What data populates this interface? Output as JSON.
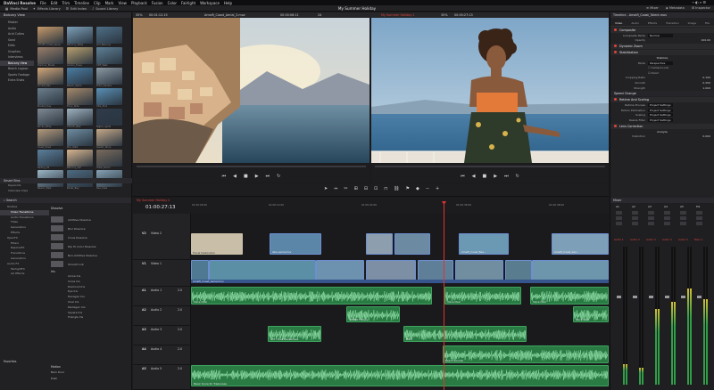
{
  "menu": {
    "app": "DaVinci Resolve",
    "items": [
      "File",
      "Edit",
      "Trim",
      "Timeline",
      "Clip",
      "Mark",
      "View",
      "Playback",
      "Fusion",
      "Color",
      "Fairlight",
      "Workspace",
      "Help"
    ]
  },
  "toolbar": {
    "media_pool": "Media Pool",
    "effects_library": "Effects Library",
    "edit_index": "Edit Index",
    "sound_library": "Sound Library",
    "project_title": "My Summer Holiday",
    "mixer": "Mixer",
    "metadata": "Metadata",
    "inspector": "Inspector"
  },
  "media_pool": {
    "bin_title": "Balcony View",
    "bins": [
      "Master",
      "Audio",
      "Acid Cuttes",
      "Sand",
      "Edits",
      "Graphics",
      "Interviews",
      "Balcony View",
      "Beach Lagoon",
      "Sports Footage",
      "Extra Shots"
    ],
    "active_bin": "Balcony View",
    "clips": [
      "Amalfi_Coast_Aerial",
      "Balcony_Wide",
      "Girl_Balcony",
      "Harbour_Boats",
      "Lemon_Trees",
      "Cliff_Walk",
      "Sunset_Pan",
      "Beach_Swim",
      "Town_Square",
      "Market_Day",
      "Ferry_Ride",
      "Villa_Pool",
      "Rocks_Wide",
      "Church_Bell",
      "Night_Lights",
      "Coast_Road",
      "Pier_Walk",
      "Gelato_Shop",
      "Sailing_02",
      "Balcony_Girl",
      "Hotel_Room",
      "Beach_Walk",
      "Boats_Bay",
      "Sea_View"
    ],
    "smart_bins_title": "Smart Bins",
    "smart_bins": [
      "Keywords",
      "Interview Clips"
    ]
  },
  "viewer": {
    "source_zoom": "35%",
    "source_tc": "00:01:12:15",
    "source_clip": "Amalfi_Coast_Aerial_3.mov",
    "source_duration": "00:00:06:11",
    "fps": "24",
    "timeline_name": "My Summer Holiday 2",
    "timeline_zoom": "35%",
    "timeline_tc": "00:00:27:13",
    "inspector_clip": "Timeline - Amalfi_Coast_Talent.mov"
  },
  "inspector": {
    "tabs": [
      "Video",
      "Audio",
      "Effects",
      "Transition",
      "Image",
      "File"
    ],
    "active_tab": "Video",
    "composite": {
      "title": "Composite",
      "mode_label": "Composite Mode",
      "mode": "Normal",
      "opacity_label": "Opacity",
      "opacity": "100.00"
    },
    "dynamic_zoom": "Dynamic Zoom",
    "stabilization": {
      "title": "Stabilization",
      "mode_label": "Mode",
      "mode": "Perspective",
      "option_a": "Camera Lock",
      "option_b": "Zoom",
      "ratio_label": "Cropping Ratio",
      "ratio": "0.100",
      "smooth_label": "Smooth",
      "smooth": "0.250",
      "strength_label": "Strength",
      "strength": "1.000",
      "stabilize": "Stabilize"
    },
    "speed_change": "Speed Change",
    "retime": {
      "title": "Retime And Scaling",
      "process_label": "Retime Process",
      "process": "Project Settings",
      "motion_label": "Motion Estimation",
      "motion": "Project Settings",
      "scaling_label": "Scaling",
      "scaling": "Project Settings",
      "filter_label": "Resize Filter",
      "filter": "Project Settings"
    },
    "lens": {
      "title": "Lens Correction",
      "analyze": "Analyze",
      "distortion_label": "Distortion",
      "distortion": "0.000"
    }
  },
  "effects": {
    "search": "Search",
    "tree": [
      "Toolbox",
      "Video Transitions",
      "Audio Transitions",
      "Titles",
      "Generators",
      "Effects",
      "OpenFX",
      "Filters",
      "ResolveFX",
      "Transitions",
      "Generators",
      "Audio FX",
      "FairlightFX",
      "AU Effects"
    ],
    "active": "Video Transitions",
    "section_dissolve": "Dissolve",
    "dissolves": [
      "Additive Dissolve",
      "Blur Dissolve",
      "Cross Dissolve",
      "Dip To Color Dissolve",
      "Non-Additive Dissolve",
      "Smooth Cut"
    ],
    "section_iris": "Iris",
    "iris": [
      "Arrow Iris",
      "Cross Iris",
      "Diamond Iris",
      "Eye Iris",
      "Hexagon Iris",
      "Oval Iris",
      "Pentagon Iris",
      "Square Iris",
      "Triangle Iris"
    ],
    "favorites": "Favorites",
    "section_motion": "Motion",
    "motion": [
      "Barn Door",
      "Push"
    ]
  },
  "timeline": {
    "timecode": "01:00:27:13",
    "ticks": [
      "01:00:00:00",
      "01:00:12:00",
      "01:00:24:00",
      "01:00:36:00",
      "01:00:48:00"
    ],
    "tracks": [
      {
        "id": "V2",
        "name": "Video 2"
      },
      {
        "id": "V1",
        "name": "Video 1"
      },
      {
        "id": "A1",
        "name": "Audio 1",
        "ch": "2.0"
      },
      {
        "id": "A2",
        "name": "Audio 2",
        "ch": "2.0"
      },
      {
        "id": "A3",
        "name": "Audio 3",
        "ch": "2.0"
      },
      {
        "id": "A4",
        "name": "Audio 4",
        "ch": "2.0"
      },
      {
        "id": "A5",
        "name": "Audio 5",
        "ch": "2.0"
      }
    ],
    "v2_clips": [
      "Travel Destination",
      "lake aerial.mov",
      "Amalfi_Coast_Bea...",
      "Amalfi_Coast_Aeri..."
    ],
    "v1_clips": [
      "Amalfi_Coast_Aerial.mov",
      "girl and mountains.mov",
      "Amalfi_Coast_Talent...",
      "Green_By_Balcony",
      "Amalfi_Coast_Wall...",
      "people running.mov",
      "Lake by mountains.mov"
    ],
    "a1_clips": [
      "Voice Over",
      "Voice Over",
      "Voice Over"
    ],
    "a2_clips": [
      "SOUND FX.wav",
      "Voice Over"
    ],
    "a3_clips": [
      "SFX - Dive Reveal.wav",
      "Wind"
    ],
    "a4_clips": [
      "Beach Sounds"
    ],
    "a5_clips": [
      "Music Score for Trailer.wav"
    ]
  },
  "mixer": {
    "title": "Mixer",
    "channels": [
      "A1",
      "A2",
      "A3",
      "A4",
      "A5",
      "M1"
    ],
    "labels": [
      "Audio 1",
      "Audio 2",
      "Audio 3",
      "Audio 4",
      "Audio 5",
      "Main 1"
    ],
    "levels": [
      0.15,
      0.12,
      0.55,
      0.6,
      0.7,
      0.62
    ]
  }
}
